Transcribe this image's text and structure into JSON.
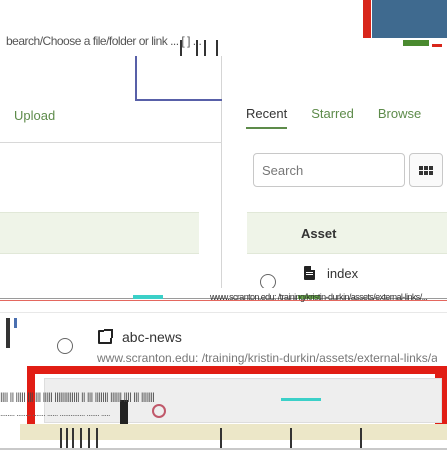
{
  "header": {
    "noise_text": "bearch/Choose a file/folder or link ... [ ] ... "
  },
  "left_panel": {
    "upload_label": "Upload"
  },
  "right_panel": {
    "tabs": [
      {
        "label": "Recent",
        "active": true
      },
      {
        "label": "Starred",
        "active": false
      },
      {
        "label": "Browse",
        "active": false
      }
    ],
    "search_placeholder": "Search",
    "asset_column_header": "Asset",
    "rows": [
      {
        "label": "index",
        "icon": "file-icon"
      }
    ]
  },
  "lower": {
    "row": {
      "label": "abc-news",
      "icon": "external-link-icon",
      "url": "www.scranton.edu: /training/kristin-durkin/assets/external-links/a"
    },
    "glitch_text": "www.scranton.edu: /training/kristin-durkin/assets/external-links/...",
    "noise_row_text": "|||| || ||||| ||| ||| ||||| ||||||||||||| || ||| ||||||| |||||| |||| ||| |||||||",
    "noise_row2_text": "........ ........ ....... ...... .............. ....... ....."
  },
  "colors": {
    "accent_green": "#5d8b4a",
    "header_blue": "#3f6a8f",
    "alert_red": "#e11d14",
    "row_highlight": "#eff4e8"
  }
}
